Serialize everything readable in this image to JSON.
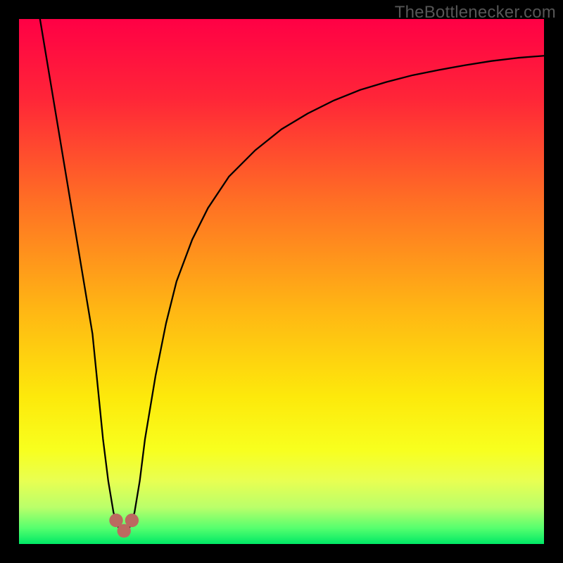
{
  "watermark": "TheBottlenecker.com",
  "gradient": {
    "stops": [
      {
        "offset": 0.0,
        "color": "#ff0045"
      },
      {
        "offset": 0.15,
        "color": "#ff2538"
      },
      {
        "offset": 0.35,
        "color": "#ff7024"
      },
      {
        "offset": 0.55,
        "color": "#ffb514"
      },
      {
        "offset": 0.72,
        "color": "#fde90b"
      },
      {
        "offset": 0.82,
        "color": "#f8ff1e"
      },
      {
        "offset": 0.88,
        "color": "#e8ff52"
      },
      {
        "offset": 0.93,
        "color": "#baff6a"
      },
      {
        "offset": 0.97,
        "color": "#55ff6e"
      },
      {
        "offset": 1.0,
        "color": "#00e866"
      }
    ]
  },
  "chart_data": {
    "type": "line",
    "title": "",
    "xlabel": "",
    "ylabel": "",
    "xlim": [
      0,
      100
    ],
    "ylim": [
      0,
      100
    ],
    "series": [
      {
        "name": "bottleneck-curve",
        "x": [
          4,
          6,
          8,
          10,
          12,
          14,
          15,
          16,
          17,
          18,
          19,
          20,
          21,
          22,
          23,
          24,
          26,
          28,
          30,
          33,
          36,
          40,
          45,
          50,
          55,
          60,
          65,
          70,
          75,
          80,
          85,
          90,
          95,
          100
        ],
        "y": [
          100,
          88,
          76,
          64,
          52,
          40,
          30,
          20,
          12,
          6,
          3,
          2,
          3,
          6,
          12,
          20,
          32,
          42,
          50,
          58,
          64,
          70,
          75,
          79,
          82,
          84.5,
          86.5,
          88,
          89.3,
          90.3,
          91.2,
          92,
          92.6,
          93
        ]
      }
    ],
    "markers": [
      {
        "name": "valley-left",
        "x": 18.5,
        "y": 4.5,
        "r": 1.3
      },
      {
        "name": "valley-bottom",
        "x": 20.0,
        "y": 2.5,
        "r": 1.3
      },
      {
        "name": "valley-right",
        "x": 21.5,
        "y": 4.5,
        "r": 1.3
      }
    ],
    "marker_color": "#bb6a60",
    "curve_color": "#000000",
    "curve_width": 2.3
  }
}
